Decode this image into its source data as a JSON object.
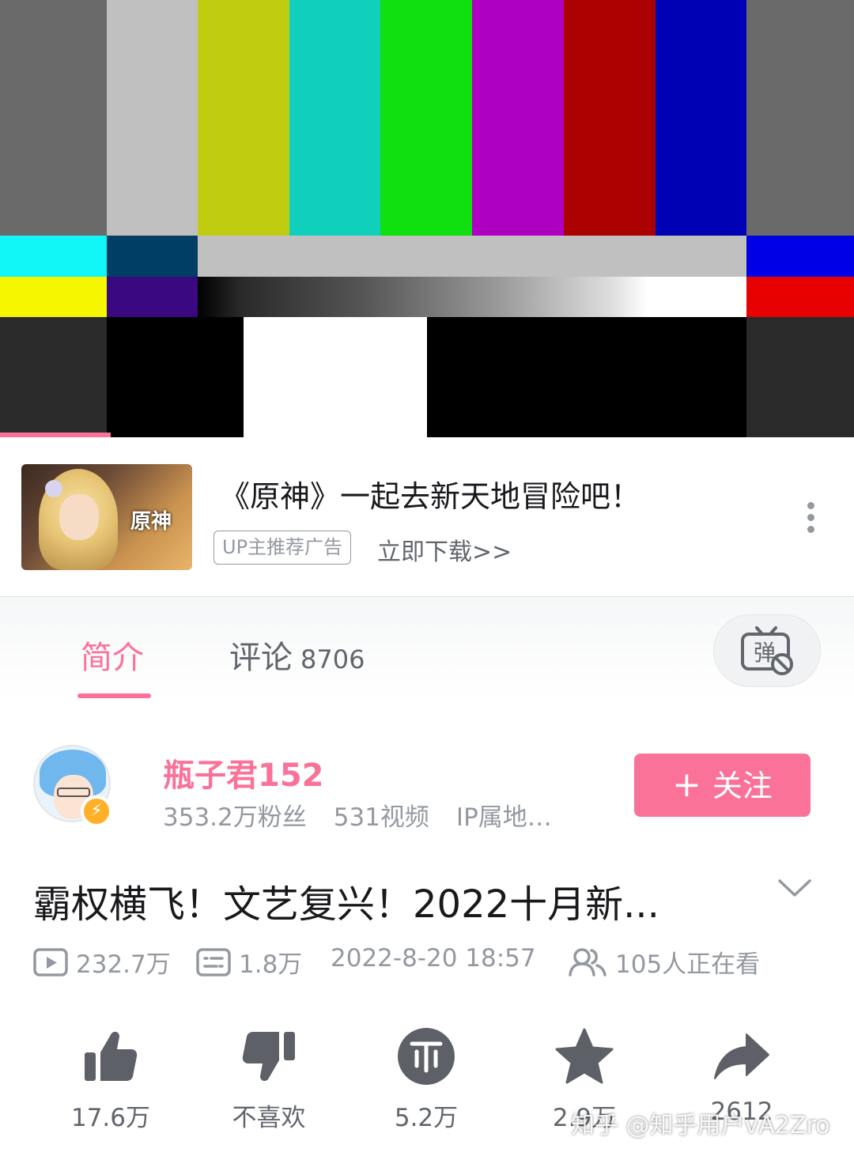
{
  "colors": {
    "accent": "#fb7299",
    "text_primary": "#18191c",
    "text_secondary": "#61666d",
    "text_muted": "#9499a0",
    "verify_badge": "#ffb027",
    "icon": "#5d6167"
  },
  "player": {
    "progress": 0.13,
    "test_pattern": {
      "top_bars": [
        "#6a6a6a",
        "#c0c0c0",
        "#c0cc10",
        "#10d0bc",
        "#10e010",
        "#ae00c0",
        "#aa0000",
        "#0000b4",
        "#6a6a6a"
      ],
      "row2": [
        "#10f6f6",
        "#003e66",
        "#c0c0c0",
        "#0000e6"
      ],
      "row3_left": [
        "#f6f600",
        "#3a0880"
      ],
      "row3_right": "#e60000",
      "row4": [
        "#2a2a2a",
        "#000000",
        "#ffffff",
        "#000000",
        "#2a2a2a"
      ]
    }
  },
  "ad": {
    "thumb_logo": "原神",
    "title": "《原神》一起去新天地冒险吧！",
    "tag": "UP主推荐广告",
    "link": "立即下载>>",
    "more_icon": "more-vertical-icon"
  },
  "tabs": {
    "intro": "简介",
    "comments": "评论",
    "comments_count": "8706",
    "danmaku_icon": "danmaku-off-icon"
  },
  "uploader": {
    "name": "瓶子君152",
    "fans": "353.2万粉丝",
    "videos": "531视频",
    "ip": "IP属地…",
    "follow_label": "关注",
    "follow_icon": "+"
  },
  "video": {
    "title": "霸权横飞！文艺复兴！2022十月新...",
    "views": "232.7万",
    "danmaku": "1.8万",
    "date": "2022-8-20 18:57",
    "watching": "105人正在看"
  },
  "actions": {
    "like": "17.6万",
    "dislike": "不喜欢",
    "coin": "5.2万",
    "favorite": "2.9万",
    "share": "2612"
  },
  "watermark": "知乎 @知乎用户vA2Zro"
}
